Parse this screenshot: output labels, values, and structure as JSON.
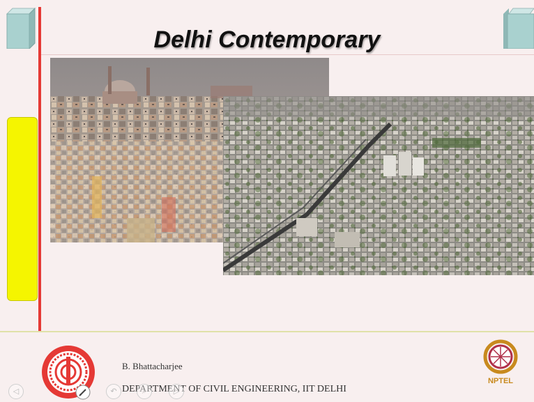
{
  "slide": {
    "title": "Delhi Contemporary"
  },
  "footer": {
    "author": "B. Bhattacharjee",
    "department": "DEPARTMENT OF CIVIL ENGINEERING, IIT DELHI",
    "logo_right_text": "NPTEL"
  },
  "colors": {
    "accent_line": "#e53935",
    "yellow_bar": "#f5f500",
    "background": "#f8efef"
  },
  "icons": {
    "nav_prev": "◁",
    "nav_next": "▷",
    "nav_back": "↶",
    "nav_forward": "↷",
    "nav_search": "⌕"
  }
}
